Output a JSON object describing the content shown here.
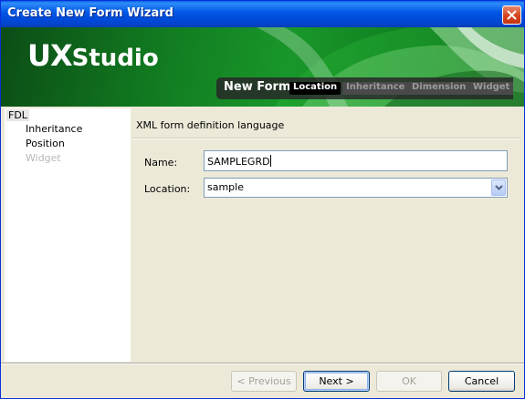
{
  "window": {
    "title": "Create New Form Wizard"
  },
  "banner": {
    "brand_ux": "UX",
    "brand_studio": "Studio",
    "steps_title": "New Form",
    "steps": [
      "Location",
      "Inheritance",
      "Dimension",
      "Widget"
    ]
  },
  "tree": {
    "items": [
      "FDL",
      "Inheritance",
      "Position",
      "Widget"
    ]
  },
  "form": {
    "section_title": "XML form definition language",
    "name_label": "Name:",
    "name_value": "SAMPLEGRD",
    "location_label": "Location:",
    "location_value": "sample"
  },
  "buttons": {
    "previous": "< Previous",
    "next": "Next >",
    "ok": "OK",
    "cancel": "Cancel"
  },
  "colors": {
    "titlebar": "#0055e5",
    "banner_green": "#19972a",
    "dialog_bg": "#ece9d8"
  }
}
